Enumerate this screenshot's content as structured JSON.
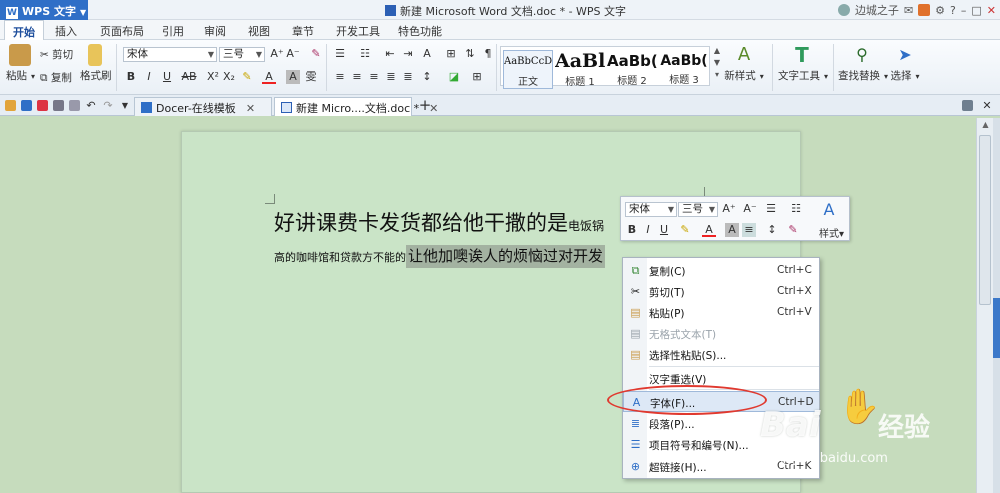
{
  "app": {
    "menu_label": "WPS 文字",
    "window_title": "新建 Microsoft Word 文档.doc * - WPS 文字",
    "user_name": "边城之子"
  },
  "ribbon_tabs": [
    "开始",
    "插入",
    "页面布局",
    "引用",
    "审阅",
    "视图",
    "章节",
    "开发工具",
    "特色功能"
  ],
  "ribbon": {
    "clipboard": {
      "paste": "粘贴",
      "cut": "剪切",
      "copy": "复制",
      "format_painter": "格式刷"
    },
    "font_name": "宋体",
    "font_size": "三号",
    "styles": [
      {
        "sample": "AaBbCcDd",
        "label": "正文"
      },
      {
        "sample": "AaBl",
        "label": "标题 1"
      },
      {
        "sample": "AaBb(",
        "label": "标题 2"
      },
      {
        "sample": "AaBb(",
        "label": "标题 3"
      }
    ],
    "new_style": "新样式",
    "text_tools": "文字工具",
    "find_replace": "查找替换",
    "select": "选择"
  },
  "doc_tabs": [
    {
      "label": "Docer-在线模板",
      "active": false
    },
    {
      "label": "新建 Micro....文档.doc *",
      "active": true
    }
  ],
  "document": {
    "line1_large": "好讲课费卡发货都给他干撒的是",
    "line1_small": "电饭锅",
    "line2_normal": "高的咖啡馆和贷款方不能的",
    "line2_selected": "让他加噢诶人的烦恼过对开发"
  },
  "mini_toolbar": {
    "font_name": "宋体",
    "font_size": "三号",
    "styles_label": "样式"
  },
  "context_menu": [
    {
      "icon": "copy-icon",
      "label": "复制(C)",
      "shortcut": "Ctrl+C",
      "disabled": false
    },
    {
      "icon": "cut-icon",
      "label": "剪切(T)",
      "shortcut": "Ctrl+X",
      "disabled": false
    },
    {
      "icon": "paste-icon",
      "label": "粘贴(P)",
      "shortcut": "Ctrl+V",
      "disabled": false
    },
    {
      "icon": "paste-text-icon",
      "label": "无格式文本(T)",
      "shortcut": "",
      "disabled": true
    },
    {
      "icon": "paste-special-icon",
      "label": "选择性粘贴(S)...",
      "shortcut": "",
      "disabled": false
    },
    {
      "icon": "",
      "label": "汉字重选(V)",
      "shortcut": "",
      "disabled": false
    },
    {
      "icon": "font-icon",
      "label": "字体(F)...",
      "shortcut": "Ctrl+D",
      "disabled": false,
      "highlighted": true
    },
    {
      "icon": "paragraph-icon",
      "label": "段落(P)...",
      "shortcut": "",
      "disabled": false
    },
    {
      "icon": "bullets-icon",
      "label": "项目符号和编号(N)...",
      "shortcut": "",
      "disabled": false
    },
    {
      "icon": "hyperlink-icon",
      "label": "超链接(H)...",
      "shortcut": "Ctrl+K",
      "disabled": false
    }
  ],
  "watermark": {
    "brand": "Bai",
    "brand2": "百度",
    "jingyan": "经验",
    "url": "jingyan.baidu.com"
  },
  "colors": {
    "page_bg": "#cae4c7",
    "workspace": "#c6dcbd",
    "accent": "#2f6fc7",
    "annotation": "#e0392f"
  }
}
